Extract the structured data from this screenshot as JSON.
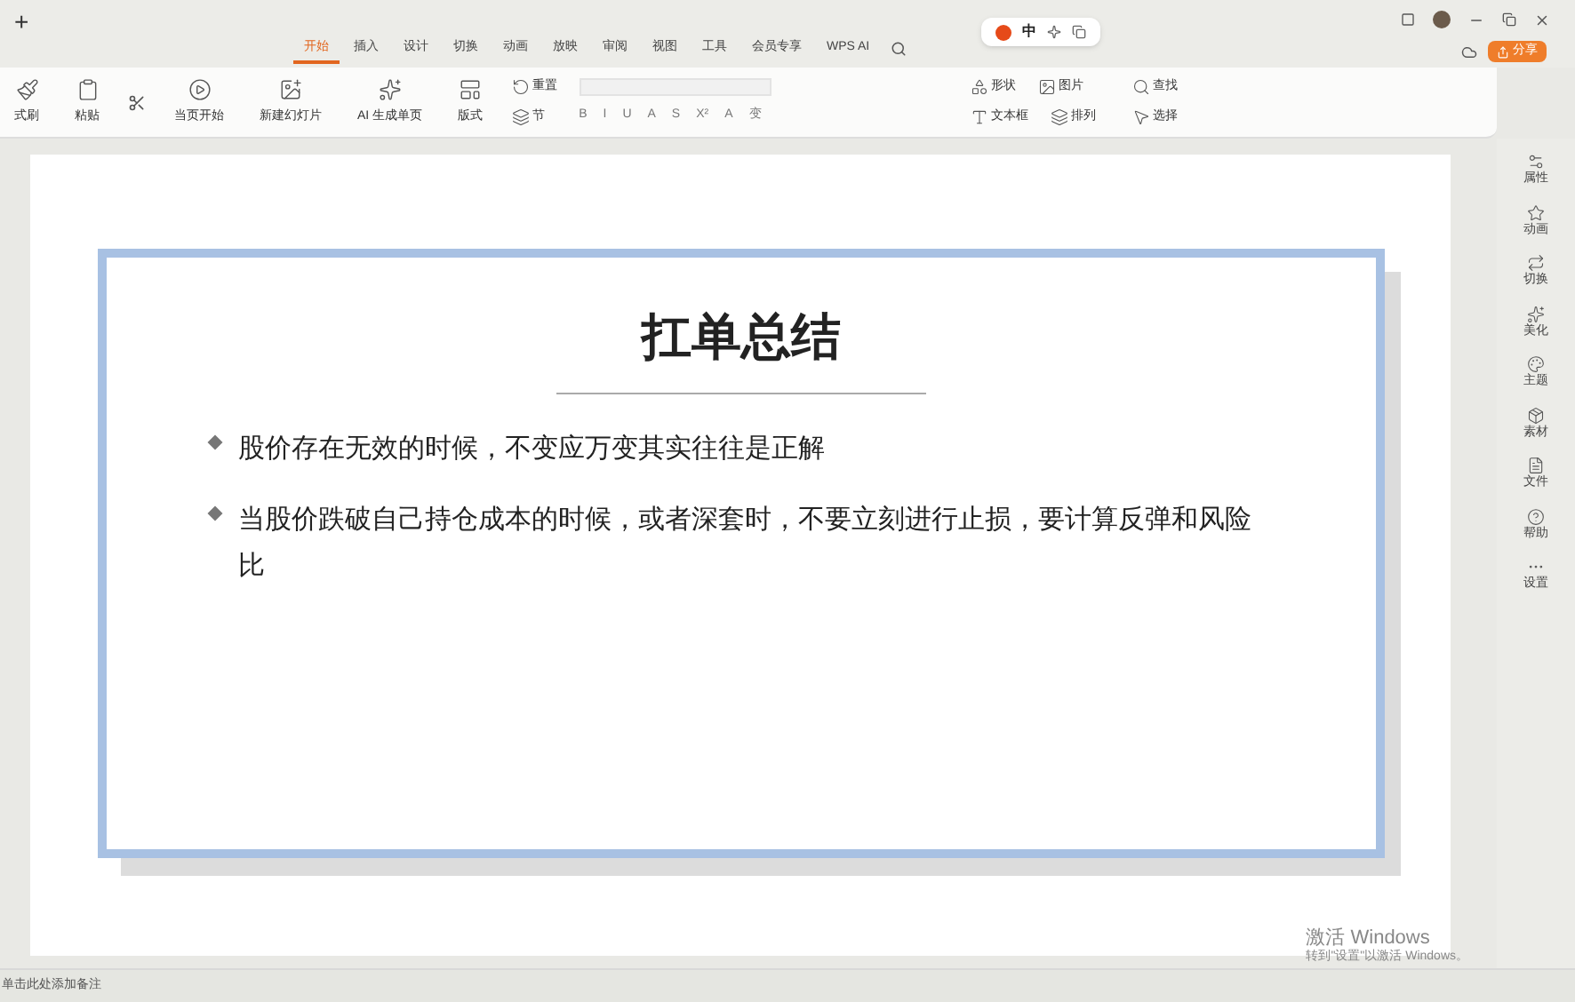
{
  "title_bar": {
    "new_tab": "+"
  },
  "tabs": [
    {
      "label": "开始",
      "selected": true
    },
    {
      "label": "插入",
      "selected": false
    },
    {
      "label": "设计",
      "selected": false
    },
    {
      "label": "切换",
      "selected": false
    },
    {
      "label": "动画",
      "selected": false
    },
    {
      "label": "放映",
      "selected": false
    },
    {
      "label": "审阅",
      "selected": false
    },
    {
      "label": "视图",
      "selected": false
    },
    {
      "label": "工具",
      "selected": false
    },
    {
      "label": "会员专享",
      "selected": false
    },
    {
      "label": "WPS AI",
      "selected": false
    }
  ],
  "ime_bar": {
    "mode": "中"
  },
  "share_button": "分享",
  "ribbon": {
    "clipboard": [
      "式刷",
      "粘贴"
    ],
    "play": "当页开始",
    "slides": [
      "新建幻灯片",
      "AI 生成单页",
      "版式"
    ],
    "section": [
      "重置",
      "节"
    ],
    "format": [
      "B",
      "I",
      "U",
      "A",
      "S",
      "X²",
      "A",
      "变"
    ],
    "drawing": [
      "形状",
      "图片",
      "文本框",
      "排列"
    ],
    "edit": [
      "查找",
      "选择"
    ]
  },
  "slide": {
    "title": "扛单总结",
    "bullets": [
      "股价存在无效的时候，不变应万变其实往往是正解",
      "当股价跌破自己持仓成本的时候，或者深套时，不要立刻进行止损，要计算反弹和风险比"
    ]
  },
  "side_panel": [
    "属性",
    "动画",
    "切换",
    "美化",
    "主题",
    "素材",
    "文件",
    "帮助",
    "设置"
  ],
  "activation": {
    "title": "激活 Windows",
    "hint": "转到\"设置\"以激活 Windows。"
  },
  "status_bar": {
    "notes": "单击此处添加备注"
  }
}
